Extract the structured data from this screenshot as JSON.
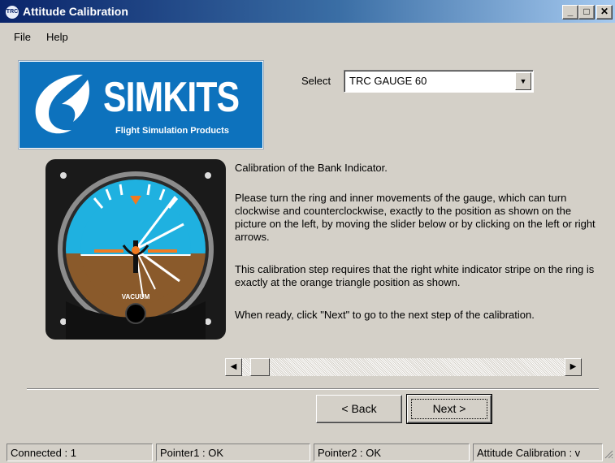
{
  "window": {
    "title": "Attitude Calibration",
    "app_icon_text": "TRC",
    "controls": {
      "minimize": "_",
      "maximize": "□",
      "close": "✕"
    }
  },
  "menu": [
    {
      "label": "File"
    },
    {
      "label": "Help"
    }
  ],
  "logo": {
    "name": "SIMKITS",
    "tagline": "Flight Simulation Products",
    "background": "#0d72bd"
  },
  "select": {
    "label": "Select",
    "value": "TRC GAUGE 60"
  },
  "gauge": {
    "icon": "attitude-indicator-icon",
    "label": "VACUUM",
    "sky_color": "#1fb1e0",
    "ground_color": "#8a5a2b",
    "marker_color": "#f07a20"
  },
  "instructions": {
    "title": "Calibration of the Bank Indicator.",
    "para1": "Please turn the ring and inner movements of the gauge, which can turn clockwise and counterclockwise, exactly to the position as shown on the picture on the left, by moving the slider below or by clicking on the left or right arrows.",
    "para2": "This calibration step requires that the right white indicator stripe on the ring is exactly at the orange triangle position as shown.",
    "para3": "When ready, click \"Next\" to go to the next step of the calibration."
  },
  "slider": {
    "left_arrow": "◀",
    "right_arrow": "▶",
    "position": 0.03
  },
  "buttons": {
    "back": "< Back",
    "next": "Next >"
  },
  "status": {
    "connected": "Connected : 1",
    "pointer1": "Pointer1 : OK",
    "pointer2": "Pointer2 : OK",
    "mode": "Attitude Calibration : v"
  }
}
